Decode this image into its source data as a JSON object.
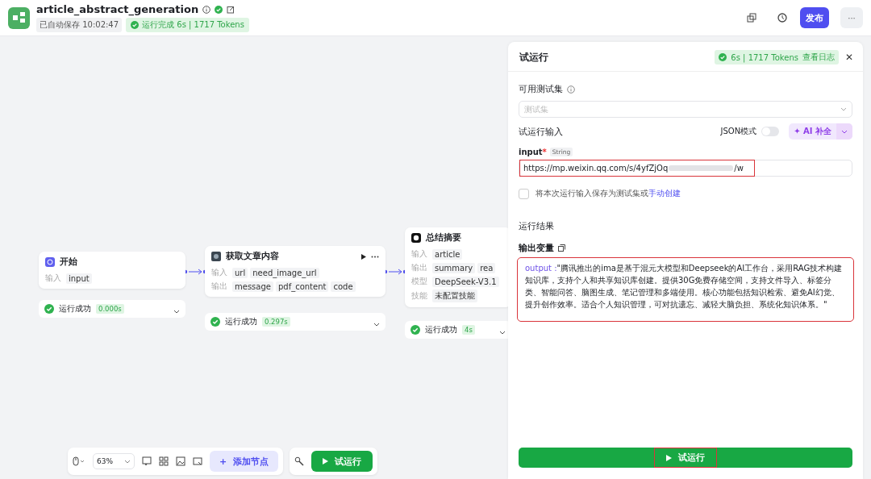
{
  "header": {
    "title": "article_abstract_generation",
    "autosave": "已自动保存 10:02:47",
    "run_status": "运行完成 6s | 1717 Tokens",
    "publish": "发布",
    "more": "···"
  },
  "nodes": [
    {
      "kind": "start",
      "title": "开始",
      "rows": [
        {
          "label": "输入",
          "vars": [
            "input"
          ]
        }
      ],
      "status": "运行成功",
      "time": "0.000s"
    },
    {
      "kind": "plugin",
      "title": "获取文章内容",
      "rows": [
        {
          "label": "输入",
          "vars": [
            "url",
            "need_image_url"
          ]
        },
        {
          "label": "输出",
          "vars": [
            "message",
            "pdf_content",
            "code"
          ]
        }
      ],
      "status": "运行成功",
      "time": "0.297s"
    },
    {
      "kind": "llm",
      "title": "总结摘要",
      "rows": [
        {
          "label": "输入",
          "vars": [
            "article"
          ]
        },
        {
          "label": "输出",
          "vars": [
            "summary",
            "rea"
          ]
        },
        {
          "label": "模型",
          "vars": [
            "DeepSeek-V3.1"
          ]
        },
        {
          "label": "技能",
          "vars": [
            "未配置技能"
          ]
        }
      ],
      "status": "运行成功",
      "time": "4s"
    }
  ],
  "toolbar": {
    "zoom": "63%",
    "add_icon": "+",
    "add_node": "添加节点",
    "run": "试运行"
  },
  "panel": {
    "title": "试运行",
    "run_summary": "6s | 1717 Tokens",
    "view_log": "查看日志",
    "close": "✕",
    "testset_label": "可用测试集",
    "testset_placeholder": "测试集",
    "input_section": "试运行输入",
    "json_mode": "JSON模式",
    "json_on": false,
    "ai_icon": "✦",
    "ai_fill": "AI 补全",
    "field": {
      "name": "input",
      "required_mark": "*",
      "type": "String",
      "value": "https://mp.weixin.qq.com/s/4yfZjOq",
      "value_tail": "/w",
      "highlighted": true
    },
    "save_checkbox": {
      "checked": false,
      "text": "将本次运行输入保存为测试集或",
      "link": "手动创建"
    },
    "result_title": "运行结果",
    "output_vars": "输出变量",
    "output": {
      "key": "output :",
      "text": "\"腾讯推出的ima是基于混元大模型和Deepseek的AI工作台，采用RAG技术构建知识库，支持个人和共享知识库创建。提供30G免费存储空间，支持文件导入、标签分类、智能问答、脑图生成、笔记管理和多端使用。核心功能包括知识检索、避免AI幻觉、提升创作效率。适合个人知识管理，可对抗遗忘、减轻大脑负担、系统化知识体系。\"",
      "highlighted": true
    },
    "run_button": {
      "label": "试运行",
      "highlighted": true
    }
  }
}
